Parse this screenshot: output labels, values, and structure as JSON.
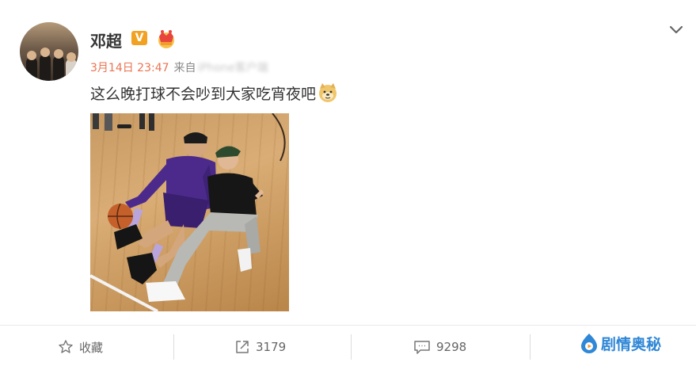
{
  "post": {
    "username": "邓超",
    "verified_badge": "V",
    "timestamp": "3月14日 23:47",
    "source_prefix": "来自",
    "source_obscured": "iPhone客户端",
    "text": "这么晚打球不会吵到大家吃宵夜吧",
    "text_emoji": "doge-emoji"
  },
  "actions": {
    "favorite_label": "收藏",
    "repost_count": "3179",
    "comment_count": "9298"
  },
  "watermark": {
    "text": "剧情奥秘"
  },
  "colors": {
    "timestamp": "#eb7350",
    "verified": "#f2a223",
    "watermark": "#2f87d6"
  }
}
